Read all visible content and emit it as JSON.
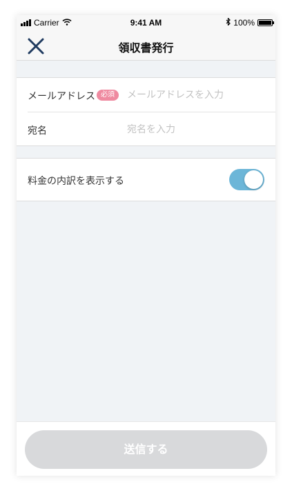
{
  "status_bar": {
    "carrier": "Carrier",
    "time": "9:41 AM",
    "battery": "100%",
    "icons": [
      "signal-icon",
      "wifi-icon",
      "bluetooth-icon",
      "battery-icon"
    ]
  },
  "nav": {
    "title": "領収書発行",
    "close_icon": "close-icon"
  },
  "form": {
    "email": {
      "label": "メールアドレス",
      "required_badge": "必須",
      "placeholder": "メールアドレスを入力",
      "value": ""
    },
    "addressee": {
      "label": "宛名",
      "placeholder": "宛名を入力",
      "value": ""
    }
  },
  "breakdown_toggle": {
    "label": "料金の内訳を表示する",
    "on": true
  },
  "submit": {
    "label": "送信する",
    "enabled": false
  },
  "colors": {
    "accent": "#6cb6d8",
    "navy": "#1f3a5f",
    "badge": "#ef8aa0",
    "disabled_button": "#d8d9db",
    "background": "#f0f3f6"
  }
}
